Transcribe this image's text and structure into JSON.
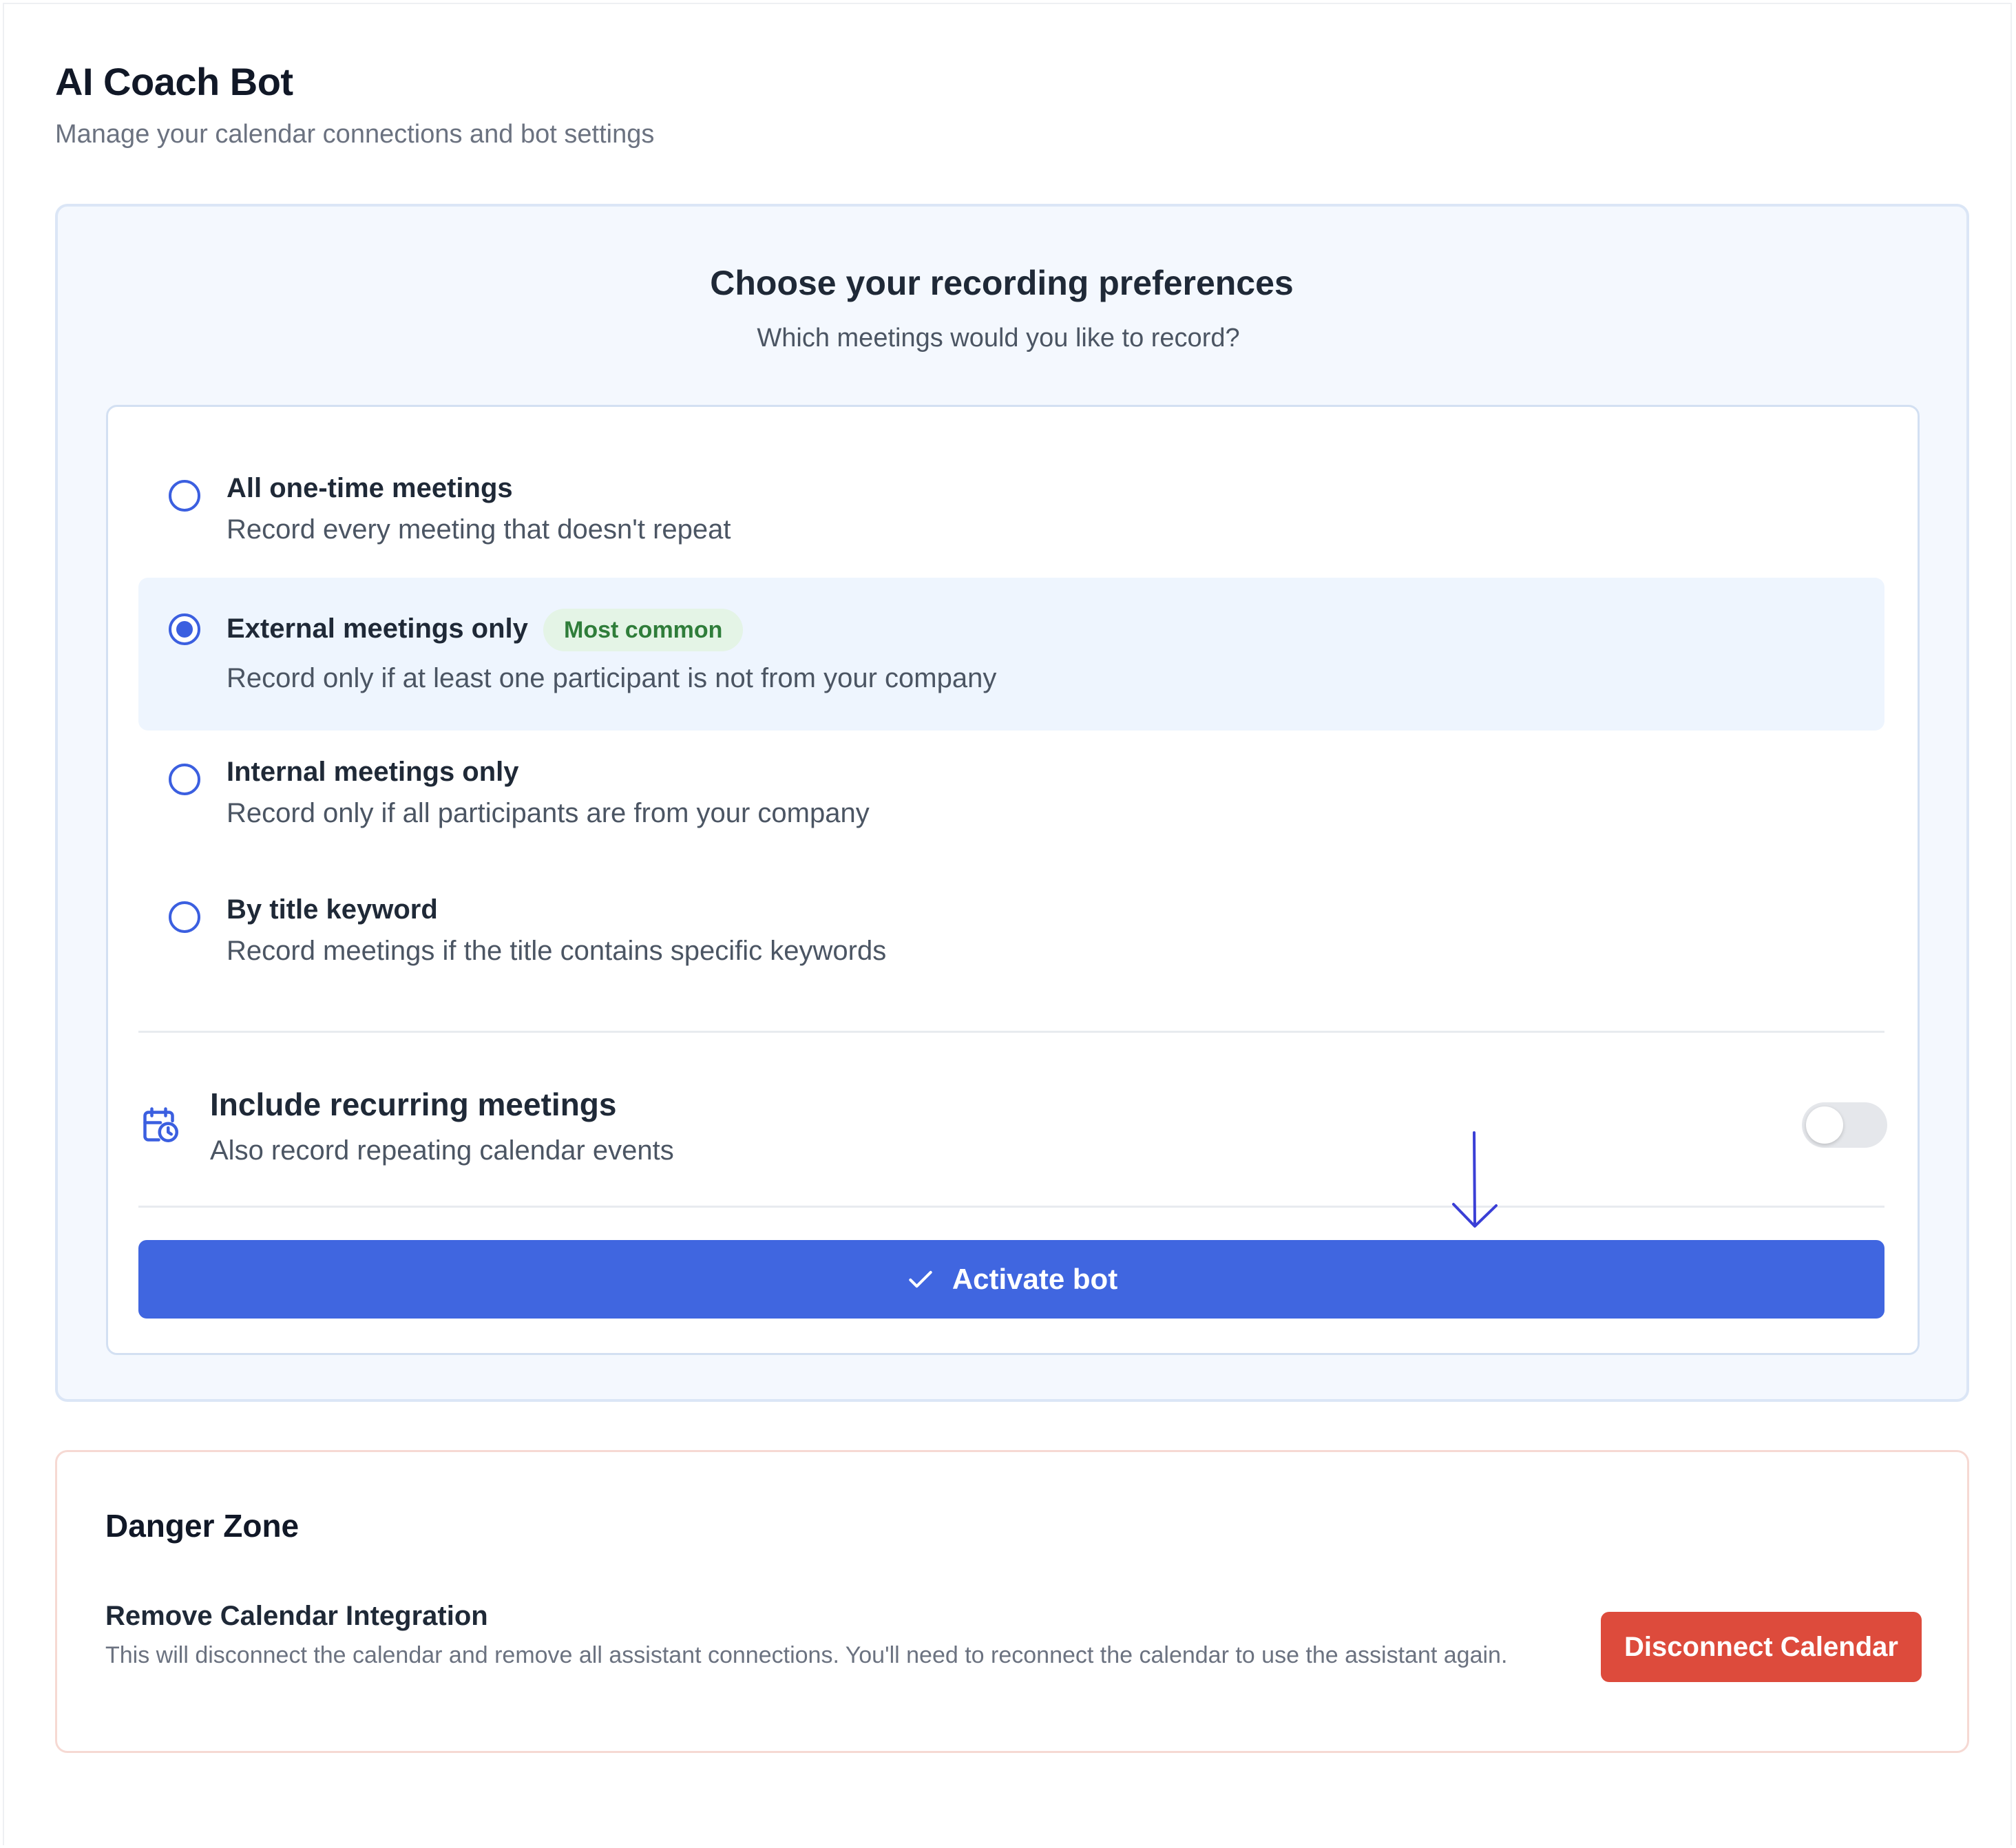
{
  "header": {
    "title": "AI Coach Bot",
    "subtitle": "Manage your calendar connections and bot settings"
  },
  "preferences": {
    "title": "Choose your recording preferences",
    "subtitle": "Which meetings would you like to record?",
    "options": [
      {
        "label": "All one-time meetings",
        "description": "Record every meeting that doesn't repeat",
        "selected": false
      },
      {
        "label": "External meetings only",
        "description": "Record only if at least one participant is not from your company",
        "selected": true,
        "badge": "Most common"
      },
      {
        "label": "Internal meetings only",
        "description": "Record only if all participants are from your company",
        "selected": false
      },
      {
        "label": "By title keyword",
        "description": "Record meetings if the title contains specific keywords",
        "selected": false
      }
    ],
    "recurring": {
      "icon": "calendar-clock-icon",
      "title": "Include recurring meetings",
      "description": "Also record repeating calendar events",
      "enabled": false
    },
    "activate_label": "Activate bot"
  },
  "danger_zone": {
    "title": "Danger Zone",
    "item_title": "Remove Calendar Integration",
    "item_description": "This will disconnect the calendar and remove all assistant connections. You'll need to reconnect the calendar to use the assistant again.",
    "button_label": "Disconnect Calendar"
  },
  "colors": {
    "primary": "#4066e0",
    "danger": "#dd4b3c",
    "badge_bg": "#e4f4e6",
    "badge_text": "#2f7d3a",
    "annotation": "#3a3fd6"
  }
}
